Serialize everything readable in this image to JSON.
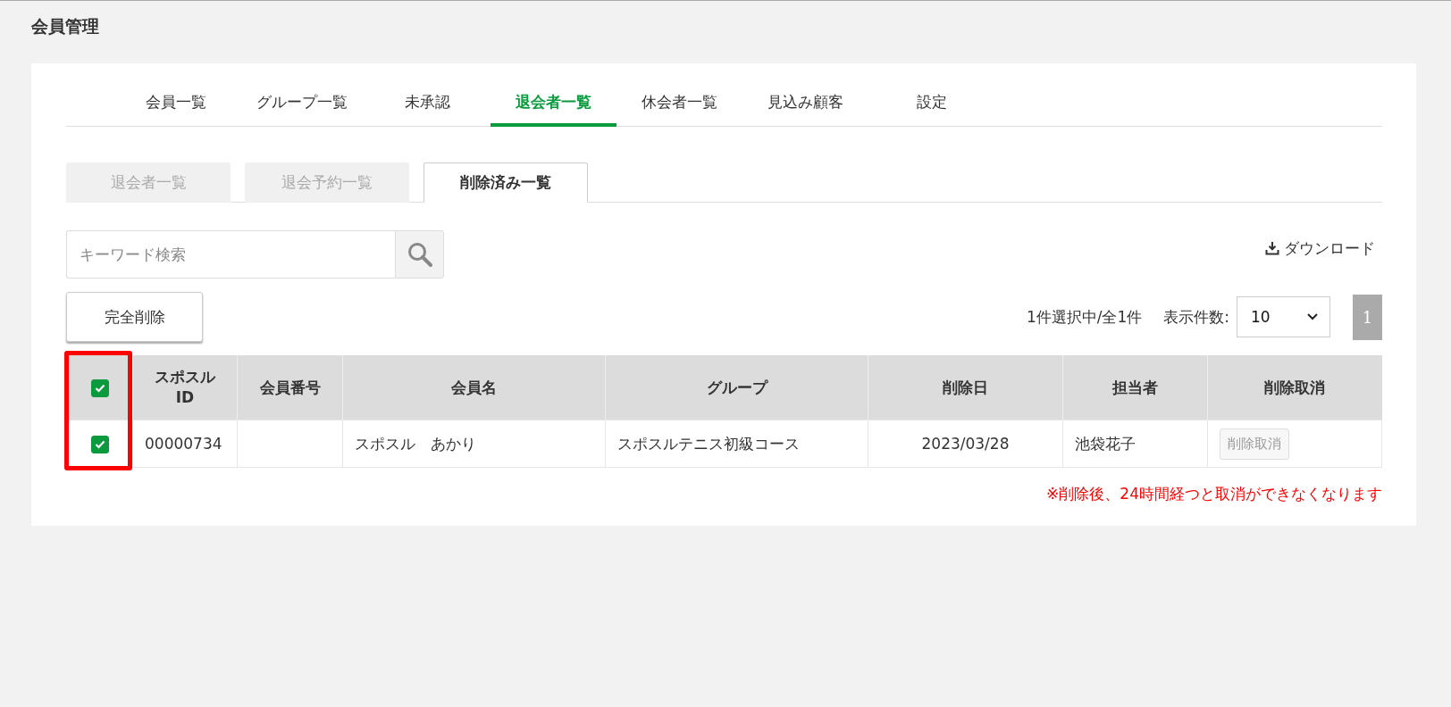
{
  "page_title": "会員管理",
  "tabs": [
    {
      "label": "会員一覧",
      "selected": false
    },
    {
      "label": "グループ一覧",
      "selected": false
    },
    {
      "label": "未承認",
      "selected": false
    },
    {
      "label": "退会者一覧",
      "selected": true
    },
    {
      "label": "休会者一覧",
      "selected": false
    },
    {
      "label": "見込み顧客",
      "selected": false
    },
    {
      "label": "設定",
      "selected": false
    }
  ],
  "sub_tabs": [
    {
      "label": "退会者一覧",
      "selected": false
    },
    {
      "label": "退会予約一覧",
      "selected": false
    },
    {
      "label": "削除済み一覧",
      "selected": true
    }
  ],
  "search": {
    "placeholder": "キーワード検索"
  },
  "download_link": "ダウンロード",
  "delete_button": "完全削除",
  "selection_count": "1件選択中/全1件",
  "per_page": {
    "label": "表示件数:",
    "value": "10"
  },
  "pages": [
    {
      "label": "1",
      "selected": true
    }
  ],
  "highlight_checkbox_column": true,
  "table": {
    "select_all_checked": true,
    "columns": [
      "スポスル\nID",
      "会員番号",
      "会員名",
      "グループ",
      "削除日",
      "担当者",
      "削除取消"
    ],
    "rows": [
      {
        "checked": true,
        "cells": [
          "00000734",
          "",
          "スポスル　あかり",
          "スポスルテニス初級コース",
          "2023/03/28",
          "池袋花子"
        ],
        "restore_button": {
          "label": "削除取消",
          "disabled": true
        }
      }
    ]
  },
  "note": "※削除後、24時間経つと取消ができなくなります"
}
